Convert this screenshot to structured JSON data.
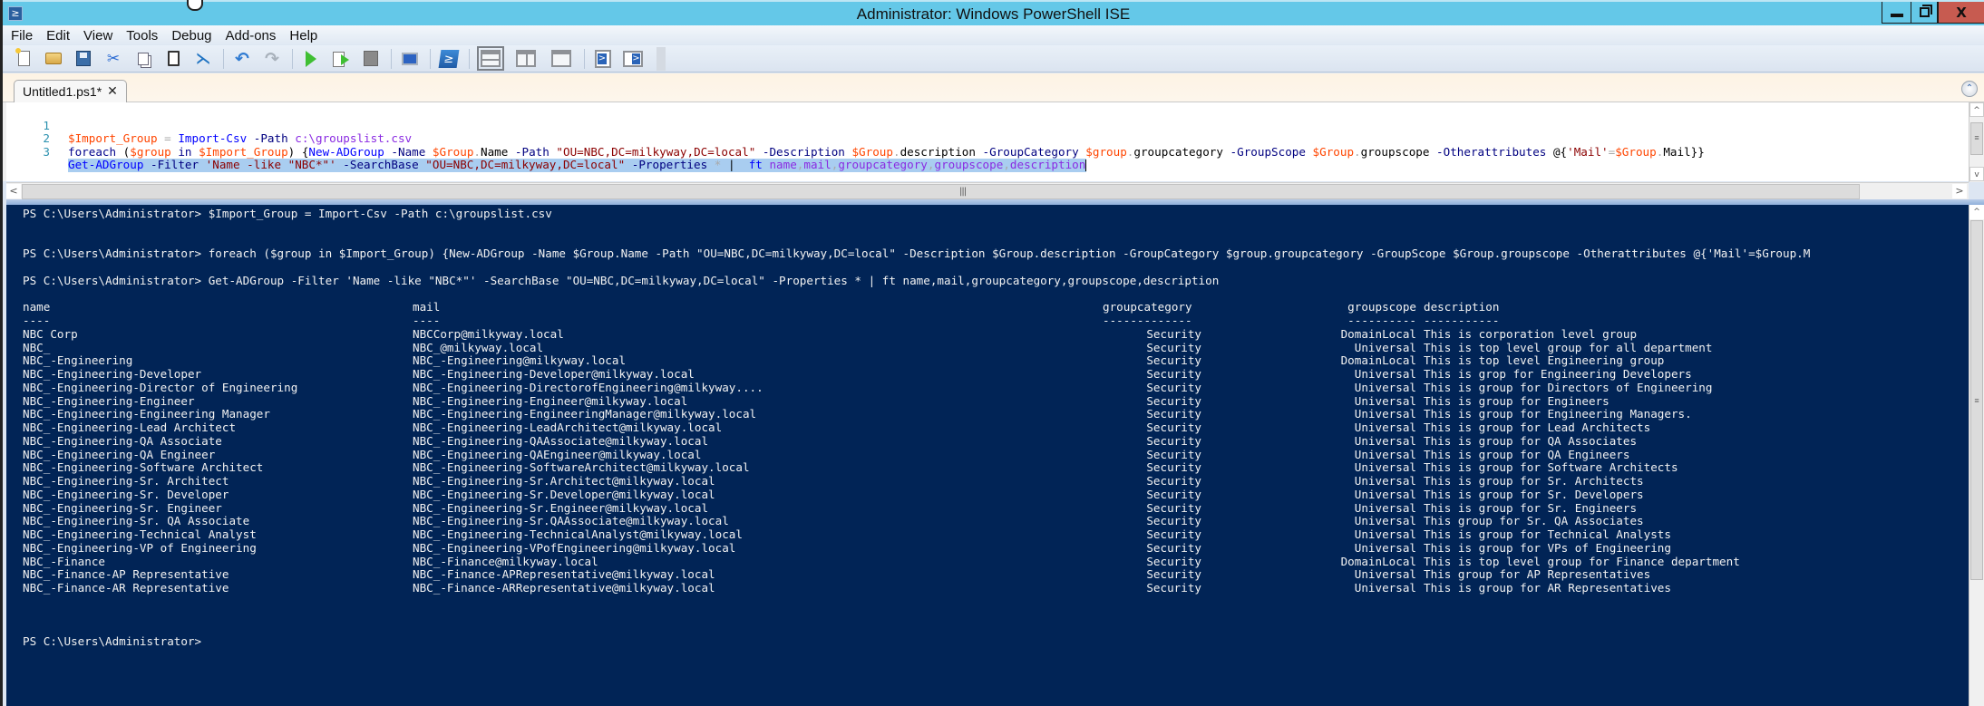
{
  "window": {
    "title": "Administrator: Windows PowerShell ISE",
    "controls": {
      "minimize": "minimize",
      "restore": "restore",
      "close": "X"
    }
  },
  "menu": [
    "File",
    "Edit",
    "View",
    "Tools",
    "Debug",
    "Add-ons",
    "Help"
  ],
  "toolbar": {
    "buttons": [
      {
        "name": "new-script",
        "icon": "new-file-icon"
      },
      {
        "name": "open-script",
        "icon": "folder-open-icon"
      },
      {
        "name": "save-script",
        "icon": "save-icon"
      },
      {
        "name": "cut",
        "icon": "scissors-icon"
      },
      {
        "name": "copy",
        "icon": "copy-icon"
      },
      {
        "name": "paste",
        "icon": "clipboard-icon"
      },
      {
        "name": "clear-console",
        "icon": "clear-icon"
      },
      {
        "name": "undo",
        "icon": "undo-icon"
      },
      {
        "name": "redo",
        "icon": "redo-icon"
      },
      {
        "name": "run-script",
        "icon": "play-icon"
      },
      {
        "name": "run-selection",
        "icon": "run-selection-icon"
      },
      {
        "name": "stop",
        "icon": "stop-icon"
      },
      {
        "name": "new-remote-tab",
        "icon": "remote-computer-icon"
      },
      {
        "name": "start-powershell",
        "icon": "powershell-icon"
      },
      {
        "name": "show-script-pane-top",
        "icon": "pane-top-icon"
      },
      {
        "name": "show-script-pane-right",
        "icon": "pane-right-icon"
      },
      {
        "name": "show-script-pane-maximized",
        "icon": "pane-max-icon"
      },
      {
        "name": "show-script-pane",
        "icon": "script-pane-icon"
      },
      {
        "name": "show-command-pane",
        "icon": "command-pane-icon"
      }
    ],
    "glyphs": {
      "cut": "✂",
      "clear": "⋋",
      "undo": "↶",
      "redo": "↷",
      "ps": "≥"
    }
  },
  "tabs": [
    {
      "label": "Untitled1.ps1*",
      "close": "✕",
      "active": true
    }
  ],
  "collapse_glyph": "⌃",
  "script": {
    "lines": [
      {
        "num": "1",
        "selected": false
      },
      {
        "num": "2",
        "selected": false
      },
      {
        "num": "3",
        "selected": true
      }
    ],
    "tokens": {
      "l1": [
        [
          "var",
          "$Import_Group"
        ],
        [
          "op",
          " = "
        ],
        [
          "cmd",
          "Import-Csv"
        ],
        [
          "param",
          " -Path "
        ],
        [
          "arg",
          "c:\\groupslist.csv"
        ]
      ],
      "l2": [
        [
          "kw",
          "foreach"
        ],
        [
          "mem",
          " ("
        ],
        [
          "var",
          "$group"
        ],
        [
          "kw",
          " in "
        ],
        [
          "var",
          "$Import_Group"
        ],
        [
          "mem",
          ") {"
        ],
        [
          "cmd",
          "New-ADGroup"
        ],
        [
          "param",
          " -Name "
        ],
        [
          "var",
          "$Group"
        ],
        [
          "op",
          "."
        ],
        [
          "prop",
          "Name"
        ],
        [
          "param",
          " -Path "
        ],
        [
          "str",
          "\"OU=NBC,DC=milkyway,DC=local\""
        ],
        [
          "param",
          " -Description "
        ],
        [
          "var",
          "$Group"
        ],
        [
          "op",
          "."
        ],
        [
          "prop",
          "description"
        ],
        [
          "param",
          " -GroupCategory "
        ],
        [
          "var",
          "$group"
        ],
        [
          "op",
          "."
        ],
        [
          "prop",
          "groupcategory"
        ],
        [
          "param",
          " -GroupScope "
        ],
        [
          "var",
          "$Group"
        ],
        [
          "op",
          "."
        ],
        [
          "prop",
          "groupscope"
        ],
        [
          "param",
          " -Otherattributes "
        ],
        [
          "mem",
          "@{"
        ],
        [
          "str",
          "'Mail'"
        ],
        [
          "op",
          "="
        ],
        [
          "var",
          "$Group"
        ],
        [
          "op",
          "."
        ],
        [
          "prop",
          "Mail"
        ],
        [
          "mem",
          "}}"
        ]
      ],
      "l3": [
        [
          "cmd",
          "Get-ADGroup"
        ],
        [
          "param",
          " -Filter "
        ],
        [
          "str",
          "'Name -like \"NBC*\"'"
        ],
        [
          "param",
          " -SearchBase "
        ],
        [
          "str",
          "\"OU=NBC,DC=milkyway,DC=local\""
        ],
        [
          "param",
          " -Properties "
        ],
        [
          "op",
          "*"
        ],
        [
          "mem",
          " | "
        ],
        [
          "cmd",
          " ft"
        ],
        [
          "arg",
          " name"
        ],
        [
          "op",
          ","
        ],
        [
          "arg",
          "mail"
        ],
        [
          "op",
          ","
        ],
        [
          "arg",
          "groupcategory"
        ],
        [
          "op",
          ","
        ],
        [
          "arg",
          "groupscope"
        ],
        [
          "op",
          ","
        ],
        [
          "arg",
          "description"
        ]
      ]
    }
  },
  "splitter_grip": "|||",
  "console": {
    "prompt": "PS C:\\Users\\Administrator>",
    "history": [
      {
        "cmd": "$Import_Group = Import-Csv -Path c:\\groupslist.csv",
        "blank_after": 1
      },
      {
        "cmd": "foreach ($group in $Import_Group) {New-ADGroup -Name $Group.Name -Path \"OU=NBC,DC=milkyway,DC=local\" -Description $Group.description -GroupCategory $group.groupcategory -GroupScope $Group.groupscope -Otherattributes @{'Mail'=$Group.M",
        "blank_after": 0
      },
      {
        "cmd": "Get-ADGroup -Filter 'Name -like \"NBC*\"' -SearchBase \"OU=NBC,DC=milkyway,DC=local\" -Properties * | ft name,mail,groupcategory,groupscope,description",
        "blank_after": 0
      }
    ],
    "table": {
      "columns": [
        "name",
        "mail",
        "groupcategory",
        "groupscope",
        "description"
      ],
      "underlines": [
        "----",
        "----",
        "-------------",
        "----------",
        "-----------"
      ],
      "rows": [
        [
          "NBC Corp",
          "NBCCorp@milkyway.local",
          "Security",
          "DomainLocal",
          "This is corporation level group"
        ],
        [
          "NBC_",
          "NBC_@milkyway.local",
          "Security",
          "Universal",
          "This is top level group for all department"
        ],
        [
          "NBC_-Engineering",
          "NBC_-Engineering@milkyway.local",
          "Security",
          "DomainLocal",
          "This is top level Engineering group"
        ],
        [
          "NBC_-Engineering-Developer",
          "NBC_-Engineering-Developer@milkyway.local",
          "Security",
          "Universal",
          "This is grop for Engineering Developers"
        ],
        [
          "NBC_-Engineering-Director of Engineering",
          "NBC_-Engineering-DirectorofEngineering@milkyway....",
          "Security",
          "Universal",
          "This is group for Directors of Engineering"
        ],
        [
          "NBC_-Engineering-Engineer",
          "NBC_-Engineering-Engineer@milkyway.local",
          "Security",
          "Universal",
          "This is group for Engineers"
        ],
        [
          "NBC_-Engineering-Engineering Manager",
          "NBC_-Engineering-EngineeringManager@milkyway.local",
          "Security",
          "Universal",
          "This is group for Engineering Managers."
        ],
        [
          "NBC_-Engineering-Lead Architect",
          "NBC_-Engineering-LeadArchitect@milkyway.local",
          "Security",
          "Universal",
          "This is group for Lead Architects"
        ],
        [
          "NBC_-Engineering-QA Associate",
          "NBC_-Engineering-QAAssociate@milkyway.local",
          "Security",
          "Universal",
          "This is group for QA Associates"
        ],
        [
          "NBC_-Engineering-QA Engineer",
          "NBC_-Engineering-QAEngineer@milkyway.local",
          "Security",
          "Universal",
          "This is group for QA Engineers"
        ],
        [
          "NBC_-Engineering-Software Architect",
          "NBC_-Engineering-SoftwareArchitect@milkyway.local",
          "Security",
          "Universal",
          "This is group for Software Architects"
        ],
        [
          "NBC_-Engineering-Sr. Architect",
          "NBC_-Engineering-Sr.Architect@milkyway.local",
          "Security",
          "Universal",
          "This is group for Sr. Architects"
        ],
        [
          "NBC_-Engineering-Sr. Developer",
          "NBC_-Engineering-Sr.Developer@milkyway.local",
          "Security",
          "Universal",
          "This is group for Sr. Developers"
        ],
        [
          "NBC_-Engineering-Sr. Engineer",
          "NBC_-Engineering-Sr.Engineer@milkyway.local",
          "Security",
          "Universal",
          "This is group for Sr. Engineers"
        ],
        [
          "NBC_-Engineering-Sr. QA Associate",
          "NBC_-Engineering-Sr.QAAssociate@milkyway.local",
          "Security",
          "Universal",
          "This group for Sr. QA Associates"
        ],
        [
          "NBC_-Engineering-Technical Analyst",
          "NBC_-Engineering-TechnicalAnalyst@milkyway.local",
          "Security",
          "Universal",
          "This is group for Technical Analysts"
        ],
        [
          "NBC_-Engineering-VP of Engineering",
          "NBC_-Engineering-VPofEngineering@milkyway.local",
          "Security",
          "Universal",
          "This is group for VPs of Engineering"
        ],
        [
          "NBC_-Finance",
          "NBC_-Finance@milkyway.local",
          "Security",
          "DomainLocal",
          "This is top level group for Finance department"
        ],
        [
          "NBC_-Finance-AP Representative",
          "NBC_-Finance-APRepresentative@milkyway.local",
          "Security",
          "Universal",
          "This group for AP Representatives"
        ],
        [
          "NBC_-Finance-AR Representative",
          "NBC_-Finance-ARRepresentative@milkyway.local",
          "Security",
          "Universal",
          "This is group for AR Representatives"
        ]
      ]
    }
  },
  "scroll_glyphs": {
    "up": "^",
    "down": "v",
    "left": "<",
    "right": ">",
    "grip": "≡"
  }
}
